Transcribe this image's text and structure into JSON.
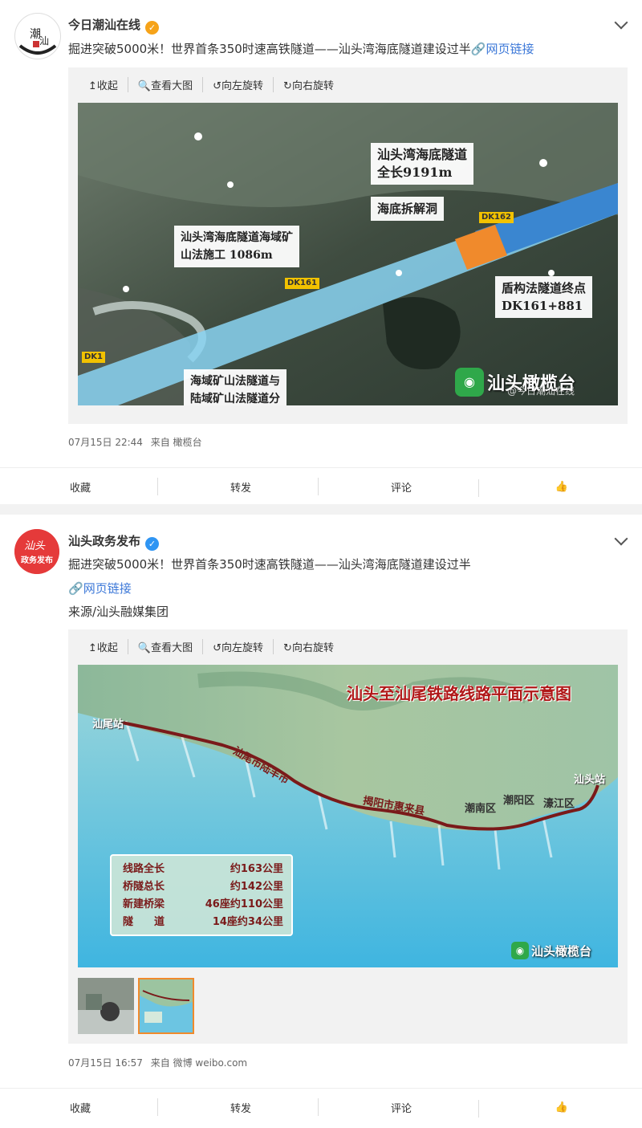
{
  "posts": [
    {
      "author": "今日潮汕在线",
      "text": "掘进突破5000米！世界首条350时速高铁隧道——汕头湾海底隧道建设过半",
      "link_text": "网页链接",
      "toolbar": [
        "收起",
        "查看大图",
        "向左旋转",
        "向右旋转"
      ],
      "image_labels": {
        "label1": "汕头湾海底隧道",
        "label1b": "全长9191m",
        "label2": "海底拆解洞",
        "label3": "汕头湾海底隧道海域矿",
        "label3b": "山法施工 1086m",
        "label4": "盾构法隧道终点",
        "label4b": "DK161+881",
        "label5": "海域矿山法隧道与",
        "label5b": "陆域矿山法隧道分",
        "dk162": "DK162",
        "dk161": "DK161",
        "dk1": "DK1",
        "logo": "汕头橄榄台",
        "watermark": "@今日潮汕在线"
      },
      "time": "07月15日 22:44",
      "source": "来自 橄榄台",
      "actions": [
        "收藏",
        "转发",
        "评论"
      ]
    },
    {
      "author": "汕头政务发布",
      "text": "掘进突破5000米！世界首条350时速高铁隧道——汕头湾海底隧道建设过半",
      "link_text": "网页链接",
      "source_line": "来源/汕头融媒集团",
      "toolbar": [
        "收起",
        "查看大图",
        "向左旋转",
        "向右旋转"
      ],
      "map": {
        "title": "汕头至汕尾铁路线路平面示意图",
        "stations": [
          "汕尾站",
          "汕尾市陆丰市",
          "揭阳市惠来县",
          "潮南区",
          "潮阳区",
          "濠江区",
          "汕头站"
        ],
        "stats": [
          [
            "线路全长",
            "约163公里"
          ],
          [
            "桥隧总长",
            "约142公里"
          ],
          [
            "新建桥梁",
            "46座约110公里"
          ],
          [
            "隧　　道",
            "14座约34公里"
          ]
        ],
        "logo": "汕头橄榄台"
      },
      "time": "07月15日 16:57",
      "source": "来自 微博 weibo.com",
      "actions": [
        "收藏",
        "转发",
        "评论"
      ]
    }
  ]
}
